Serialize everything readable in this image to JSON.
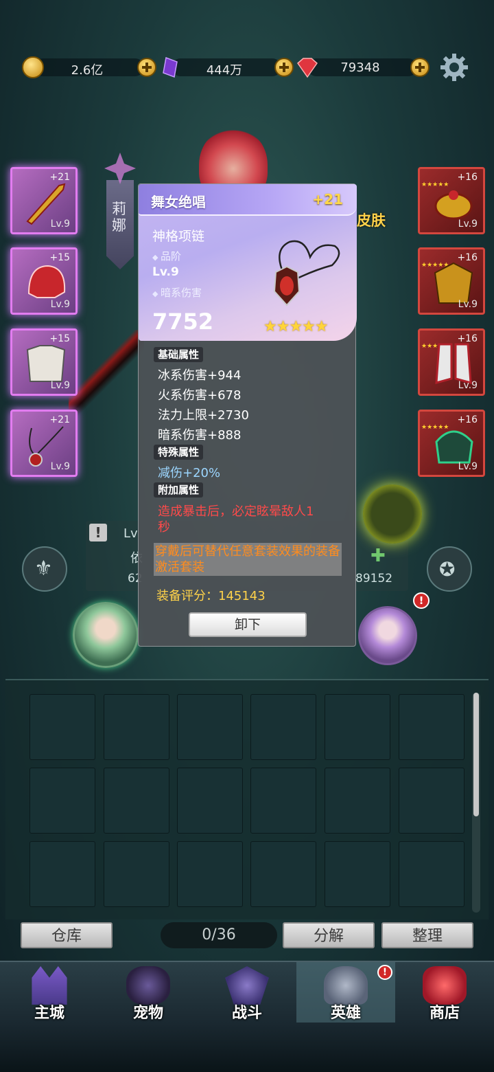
{
  "currency": {
    "gold": "2.6亿",
    "crystal": "444万",
    "ruby": "79348"
  },
  "hero": {
    "name": "莉娜",
    "skin_label": "皮肤",
    "level_prefix": "Lv",
    "stat_prefix": "依",
    "power_left_partial": "62",
    "power_right": "89152"
  },
  "left_slots": [
    {
      "plus": "+21",
      "level": "Lv.9"
    },
    {
      "plus": "+15",
      "level": "Lv.9"
    },
    {
      "plus": "+15",
      "level": "Lv.9"
    },
    {
      "plus": "+21",
      "level": "Lv.9"
    }
  ],
  "right_slots": [
    {
      "plus": "+16",
      "level": "Lv.9"
    },
    {
      "plus": "+16",
      "level": "Lv.9"
    },
    {
      "plus": "+16",
      "level": "Lv.9"
    },
    {
      "plus": "+16",
      "level": "Lv.9"
    }
  ],
  "item": {
    "set_name": "舞女绝唱",
    "enhance": "+21",
    "type": "神格项链",
    "grade_label": "品阶",
    "level": "Lv.9",
    "element_label": "暗系伤害",
    "power": "7752",
    "stars": "★★★★★",
    "base_title": "基础属性",
    "base_stats": [
      "冰系伤害+944",
      "火系伤害+678",
      "法力上限+2730",
      "暗系伤害+888"
    ],
    "special_title": "特殊属性",
    "special_stat": "减伤+20%",
    "extra_title": "附加属性",
    "extra_stat_line1": "造成暴击后，必定眩晕敌人1",
    "extra_stat_line2": "秒",
    "set_effect": "穿戴后可替代任意套装效果的装备激活套装",
    "score_label": "装备评分：145143",
    "unequip": "卸下"
  },
  "inventory": {
    "warehouse": "仓库",
    "count": "0/36",
    "decompose": "分解",
    "sort": "整理"
  },
  "nav": [
    "主城",
    "宠物",
    "战斗",
    "英雄",
    "商店"
  ],
  "colors": {
    "gold_text": "#ffd24a",
    "red_text": "#ff4a4a",
    "blue_text": "#9cd6ff",
    "orange_text": "#ff8c1e"
  }
}
